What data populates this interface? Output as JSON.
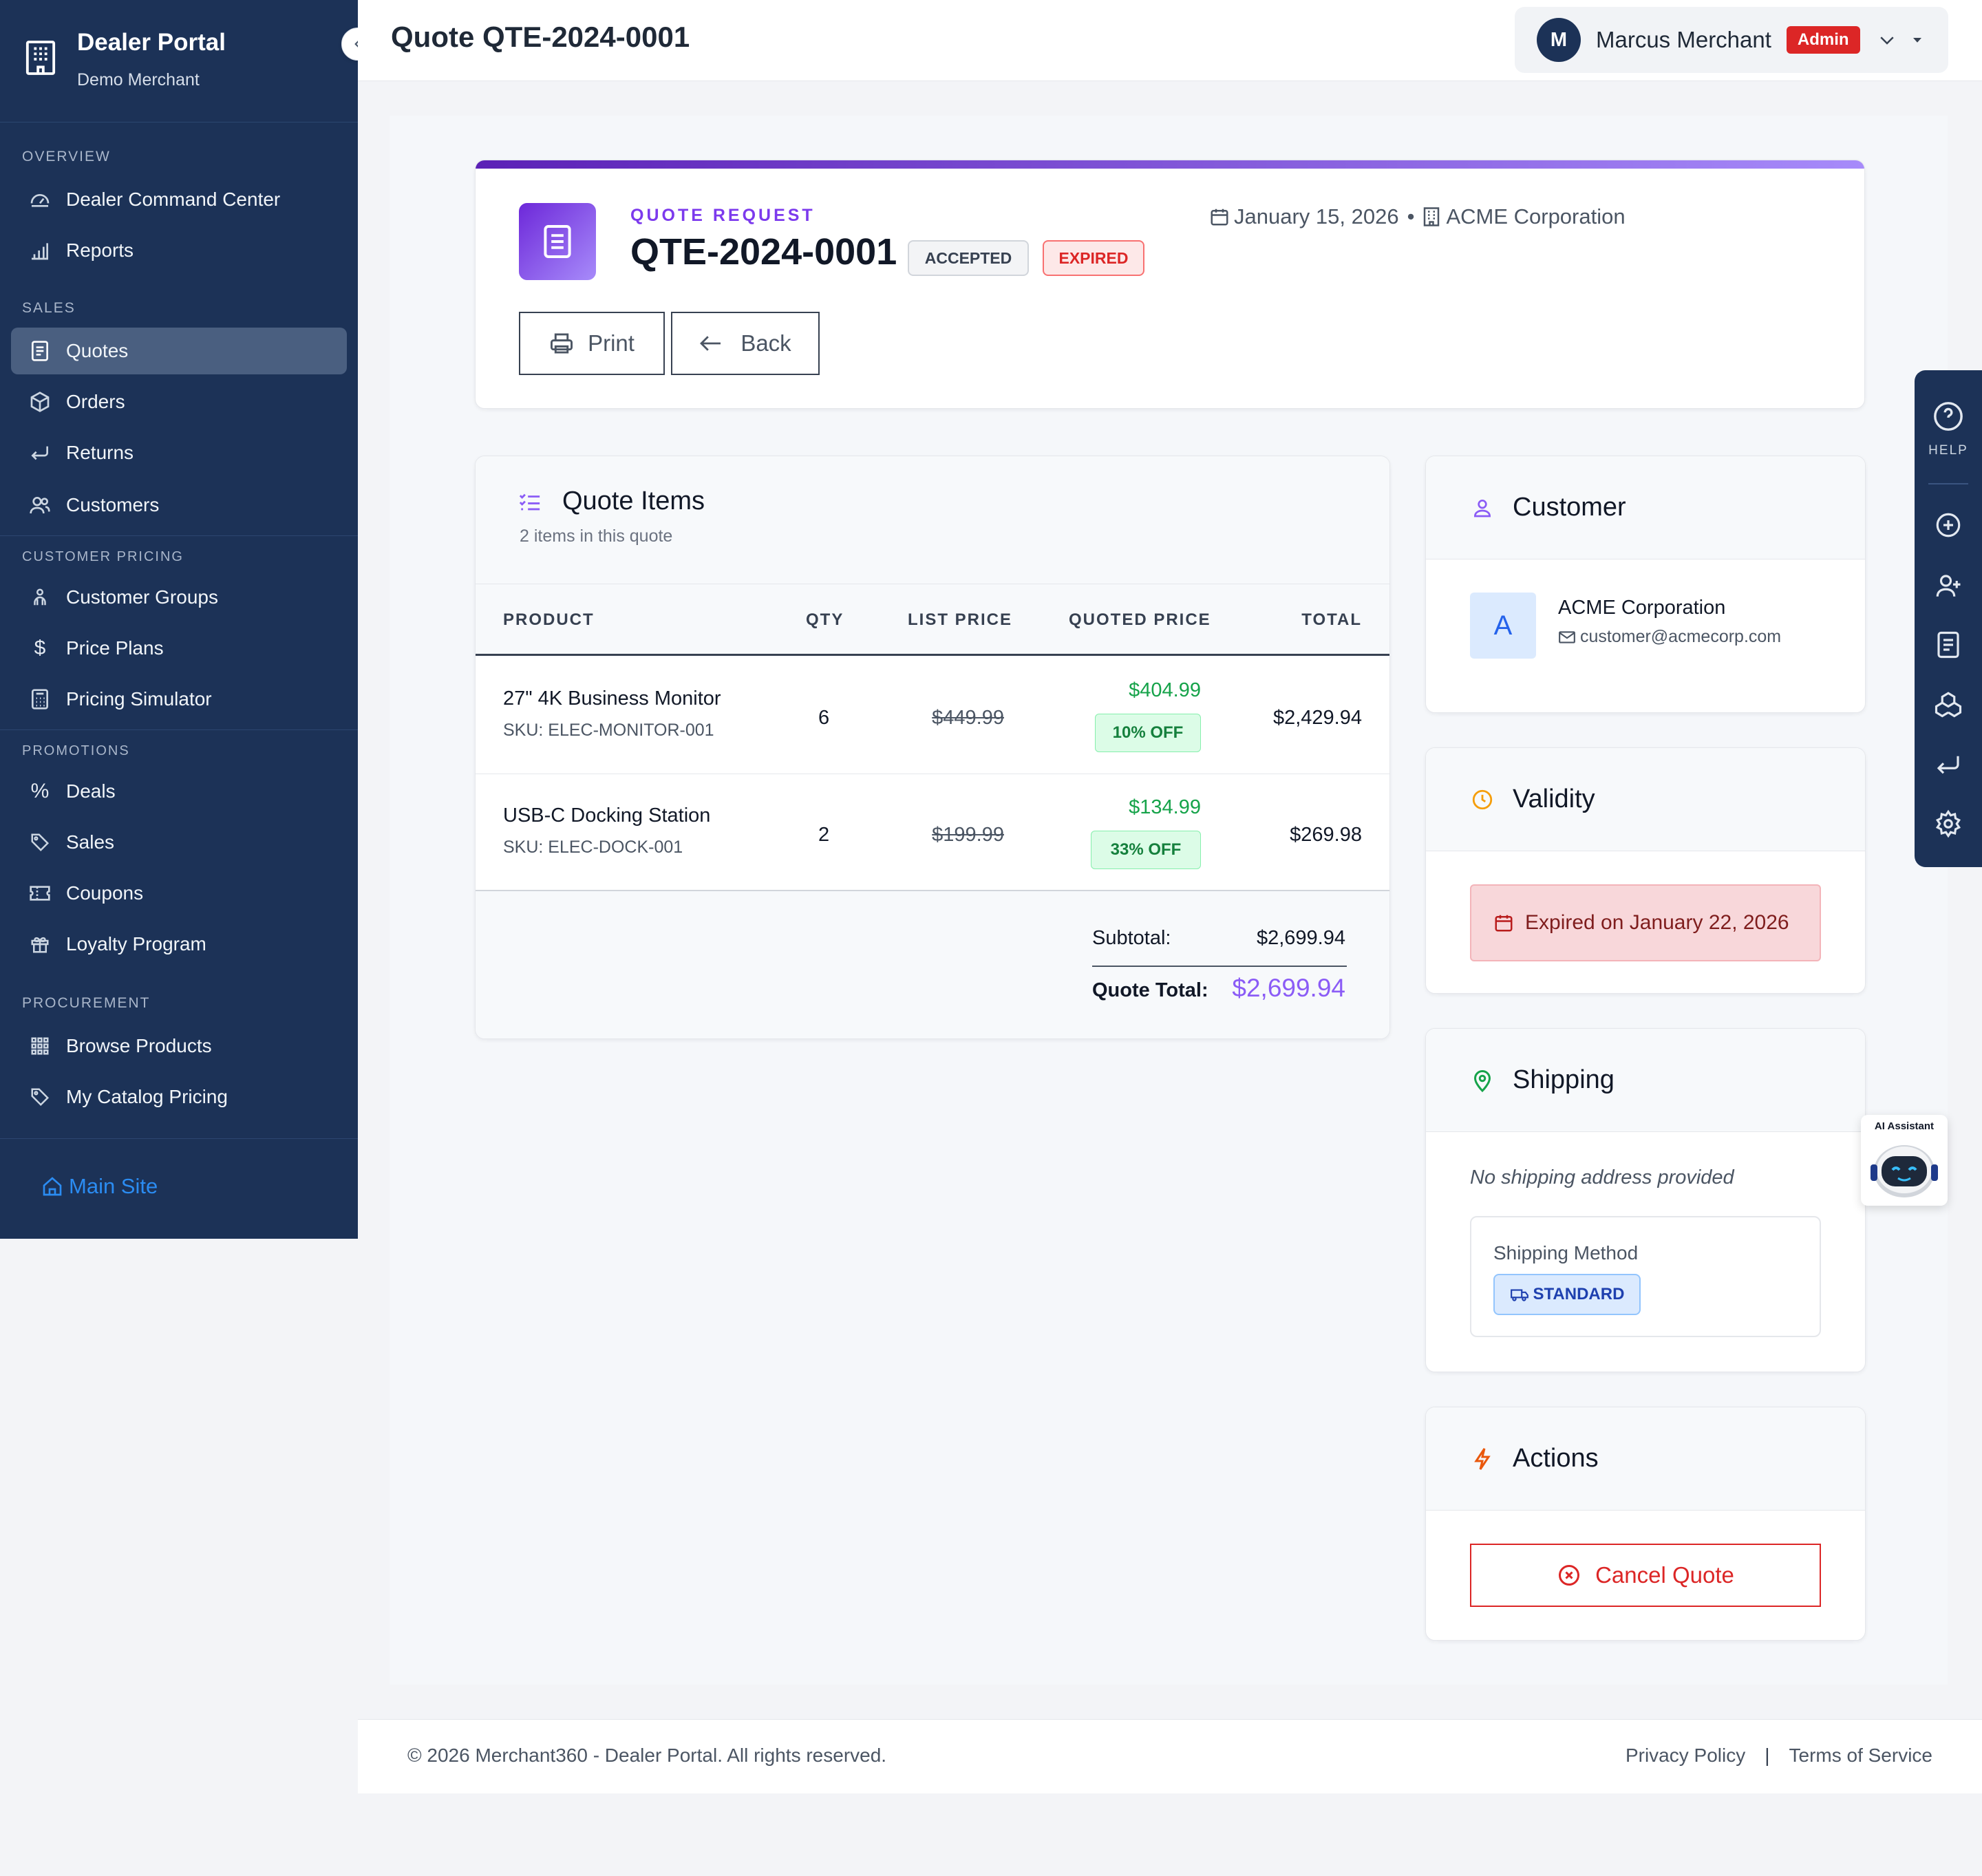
{
  "sidebar": {
    "brand_title": "Dealer Portal",
    "brand_subtitle": "Demo Merchant",
    "sections": {
      "overview": "OVERVIEW",
      "sales": "SALES",
      "customer_pricing": "CUSTOMER PRICING",
      "promotions": "PROMOTIONS",
      "procurement": "PROCUREMENT"
    },
    "items": {
      "command_center": "Dealer Command Center",
      "reports": "Reports",
      "quotes": "Quotes",
      "orders": "Orders",
      "returns": "Returns",
      "customers": "Customers",
      "customer_groups": "Customer Groups",
      "price_plans": "Price Plans",
      "pricing_simulator": "Pricing Simulator",
      "deals": "Deals",
      "sales": "Sales",
      "coupons": "Coupons",
      "loyalty_program": "Loyalty Program",
      "browse_products": "Browse Products",
      "my_catalog_pricing": "My Catalog Pricing"
    },
    "active_item": "Quotes",
    "main_site": "Main Site"
  },
  "topbar": {
    "page_title": "Quote QTE-2024-0001",
    "user_initial": "M",
    "user_name": "Marcus Merchant",
    "user_role": "Admin"
  },
  "quote": {
    "eyebrow": "QUOTE REQUEST",
    "id": "QTE-2024-0001",
    "status_1": "ACCEPTED",
    "status_2": "EXPIRED",
    "date": "January 15, 2026",
    "company": "ACME Corporation",
    "print_label": "Print",
    "back_label": "Back"
  },
  "items": {
    "title": "Quote Items",
    "subtitle": "2 items in this quote",
    "columns": {
      "product": "PRODUCT",
      "qty": "QTY",
      "list_price": "LIST PRICE",
      "quoted_price": "QUOTED PRICE",
      "total": "TOTAL"
    },
    "rows": [
      {
        "name": "27\" 4K Business Monitor",
        "sku": "SKU: ELEC-MONITOR-001",
        "qty": "6",
        "list_price": "$449.99",
        "quoted_price": "$404.99",
        "discount": "10% OFF",
        "total": "$2,429.94"
      },
      {
        "name": "USB-C Docking Station",
        "sku": "SKU: ELEC-DOCK-001",
        "qty": "2",
        "list_price": "$199.99",
        "quoted_price": "$134.99",
        "discount": "33% OFF",
        "total": "$269.98"
      }
    ],
    "subtotal_label": "Subtotal:",
    "subtotal_value": "$2,699.94",
    "total_label": "Quote Total:",
    "total_value": "$2,699.94"
  },
  "customer": {
    "title": "Customer",
    "initial": "A",
    "name": "ACME Corporation",
    "email": "customer@acmecorp.com"
  },
  "validity": {
    "title": "Validity",
    "message": "Expired on January 22, 2026"
  },
  "shipping": {
    "title": "Shipping",
    "no_address": "No shipping address provided",
    "method_label": "Shipping Method",
    "method_value": "STANDARD"
  },
  "actions": {
    "title": "Actions",
    "cancel_label": "Cancel Quote"
  },
  "tool_rail": {
    "help_label": "HELP"
  },
  "ai_assistant": {
    "label": "AI Assistant"
  },
  "footer": {
    "copyright": "© 2026 Merchant360 - Dealer Portal. All rights reserved.",
    "privacy": "Privacy Policy",
    "separator": "|",
    "terms": "Terms of Service"
  },
  "colors": {
    "sidebar_bg": "#1c3257",
    "accent_purple": "#7c3aed",
    "success_green": "#16a34a",
    "danger_red": "#dc2626",
    "link_blue": "#2b8cf2"
  }
}
